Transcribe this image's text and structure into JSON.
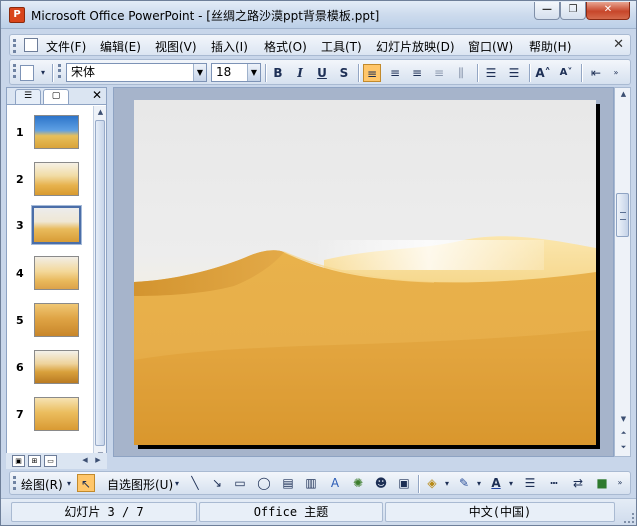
{
  "window": {
    "title": "Microsoft Office PowerPoint - [丝绸之路沙漠ppt背景模板.ppt]",
    "app_icon": "powerpoint-icon",
    "min_label": "—",
    "max_label": "❐",
    "close_label": "✕"
  },
  "menu": {
    "items": [
      "文件(F)",
      "编辑(E)",
      "视图(V)",
      "插入(I)",
      "格式(O)",
      "工具(T)",
      "幻灯片放映(D)",
      "窗口(W)",
      "帮助(H)"
    ],
    "close_glyph": "✕"
  },
  "format_toolbar": {
    "font_name": "宋体",
    "font_size": "18",
    "bold": "B",
    "italic": "I",
    "underline": "U",
    "shadow": "S",
    "align_left_active": true
  },
  "slides_pane": {
    "outline_tab_icon": "outline-icon",
    "slides_tab_icon": "slides-icon",
    "close_glyph": "✕",
    "thumbnails": [
      {
        "num": "1"
      },
      {
        "num": "2"
      },
      {
        "num": "3"
      },
      {
        "num": "4"
      },
      {
        "num": "5"
      },
      {
        "num": "6"
      },
      {
        "num": "7"
      }
    ],
    "selected": 3
  },
  "draw_toolbar": {
    "draw_label": "绘图(R)",
    "autoshapes_label": "自选图形(U)"
  },
  "status": {
    "slide_info": "幻灯片 3 / 7",
    "theme": "Office 主题",
    "language": "中文(中国)"
  },
  "colors": {
    "sand_light": "#f1cf7e",
    "sand_mid": "#e3ac45",
    "sand_dark": "#c98a26",
    "sky": "#e9e9e9",
    "accent": "#ffc66a"
  }
}
